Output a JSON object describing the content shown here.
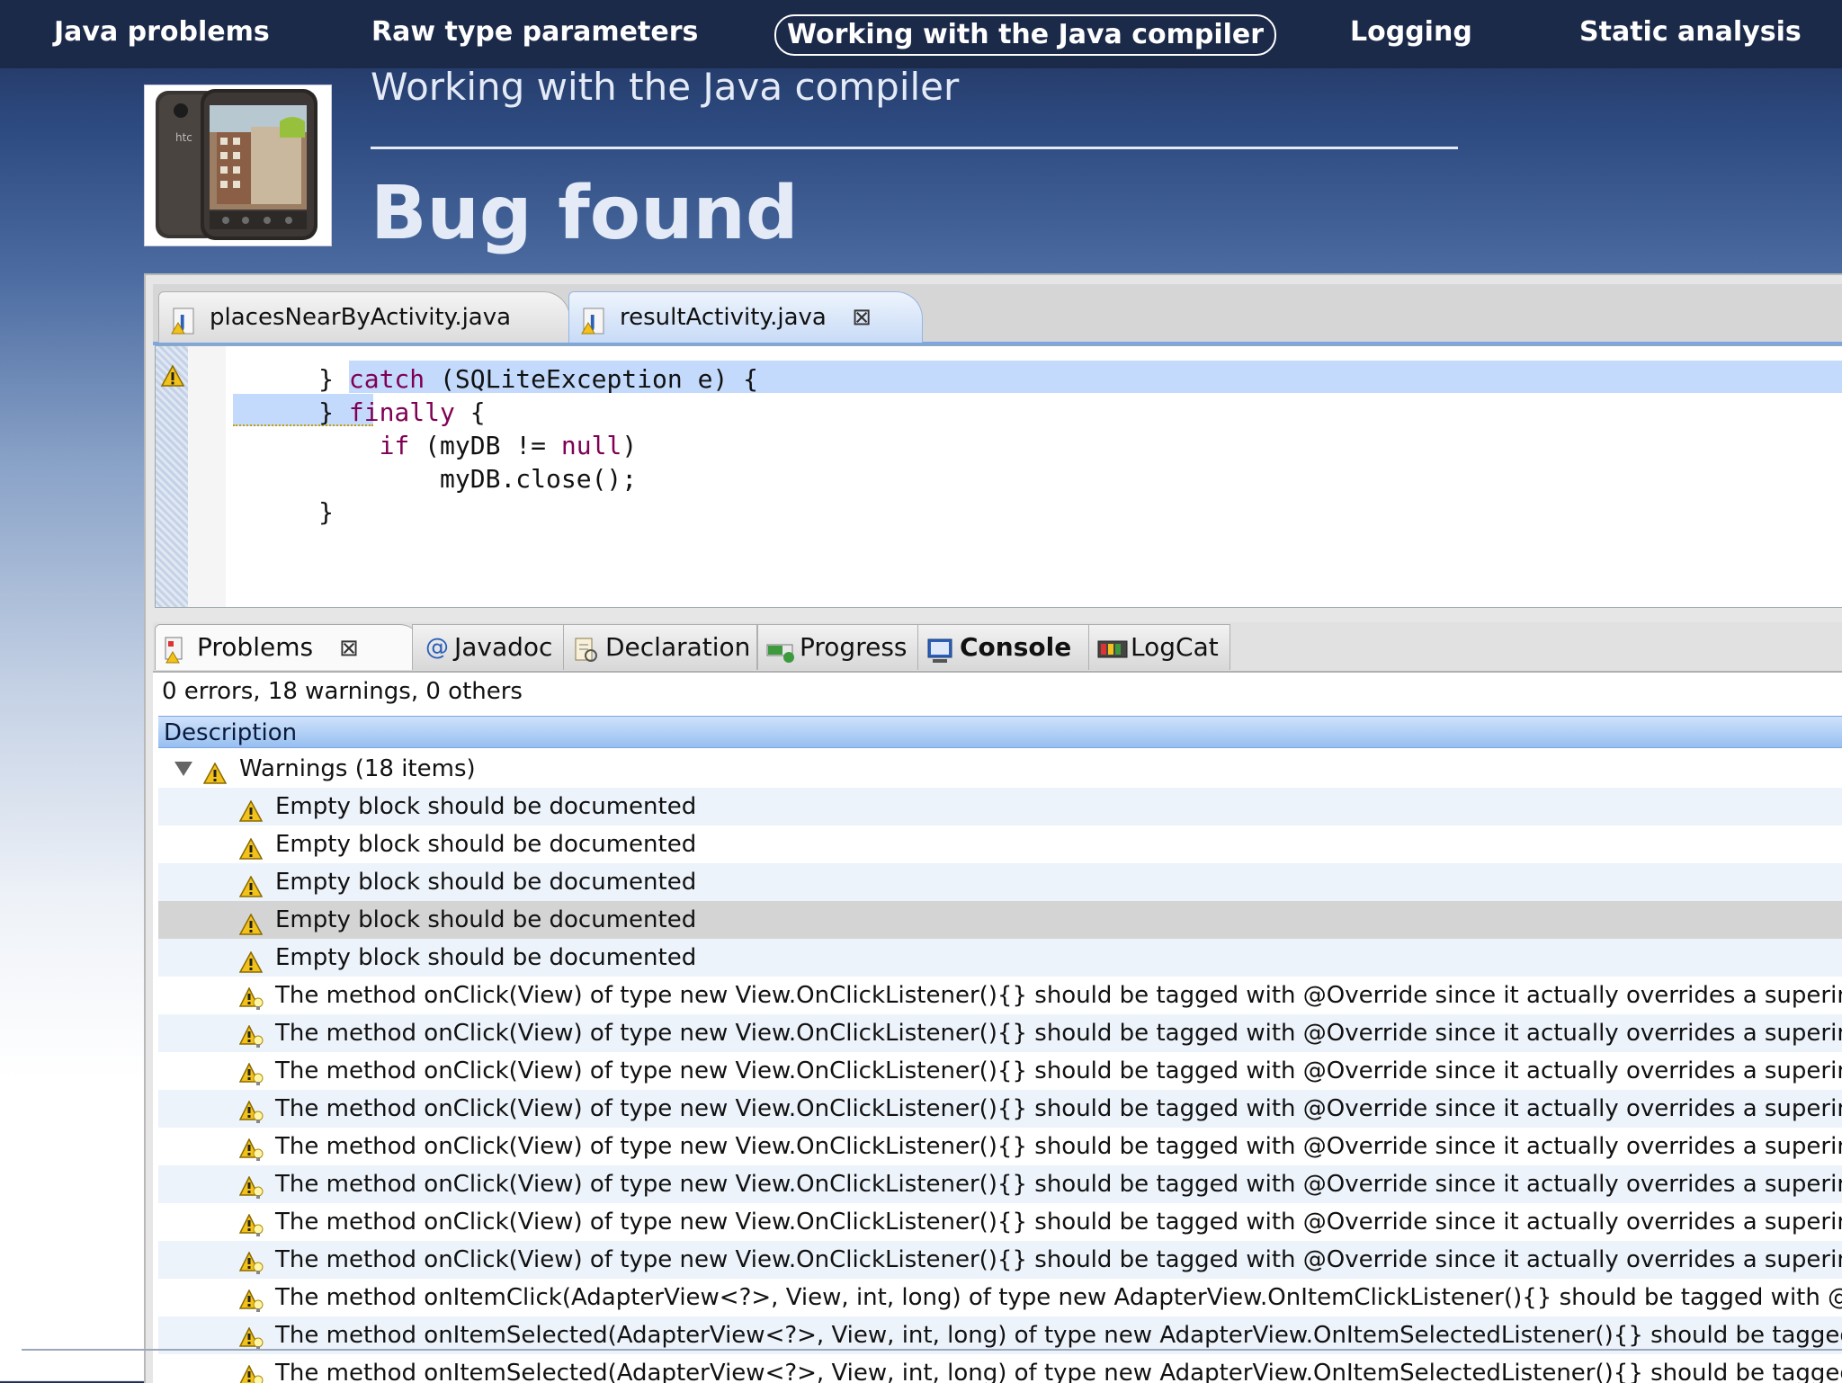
{
  "nav": {
    "items": [
      {
        "label": "Java problems",
        "active": false
      },
      {
        "label": "Raw type parameters",
        "active": false
      },
      {
        "label": "Working with the Java compiler",
        "active": true
      },
      {
        "label": "Logging",
        "active": false
      },
      {
        "label": "Static analysis",
        "active": false
      }
    ]
  },
  "slide": {
    "subtitle": "Working with the Java compiler",
    "title": "Bug found",
    "phone_logo": "htc"
  },
  "editor": {
    "tabs": [
      {
        "label": "placesNearByActivity.java",
        "active": false
      },
      {
        "label": "resultActivity.java",
        "active": true
      }
    ],
    "code": [
      {
        "pre": "      } ",
        "kw": "catch",
        "post": " (SQLiteException e) {"
      },
      {
        "pre": "      } ",
        "kw": "finally",
        "post": " {"
      },
      {
        "pre": "          ",
        "kw": "if",
        "post": " (myDB != ",
        "kw2": "null",
        "post2": ")"
      },
      {
        "pre": "              myDB.close();",
        "kw": "",
        "post": ""
      },
      {
        "pre": "      }",
        "kw": "",
        "post": ""
      }
    ]
  },
  "problems": {
    "tabs": [
      {
        "label": "Problems",
        "icon": "problems-icon",
        "active": true
      },
      {
        "label": "Javadoc",
        "icon": "at-sign-icon",
        "active": false
      },
      {
        "label": "Declaration",
        "icon": "declaration-icon",
        "active": false
      },
      {
        "label": "Progress",
        "icon": "progress-icon",
        "active": false
      },
      {
        "label": "Console",
        "icon": "console-icon",
        "active": false
      },
      {
        "label": "LogCat",
        "icon": "logcat-icon",
        "active": false
      }
    ],
    "summary": "0 errors, 18 warnings, 0 others",
    "column": "Description",
    "group": "Warnings (18 items)",
    "rows": [
      {
        "text": "Empty block should be documented",
        "kind": "warning"
      },
      {
        "text": "Empty block should be documented",
        "kind": "warning"
      },
      {
        "text": "Empty block should be documented",
        "kind": "warning"
      },
      {
        "text": "Empty block should be documented",
        "kind": "warning",
        "selected": true
      },
      {
        "text": "Empty block should be documented",
        "kind": "warning"
      },
      {
        "text": "The method onClick(View) of type new View.OnClickListener(){} should be tagged with @Override since it actually overrides a superin",
        "kind": "quickfix"
      },
      {
        "text": "The method onClick(View) of type new View.OnClickListener(){} should be tagged with @Override since it actually overrides a superin",
        "kind": "quickfix"
      },
      {
        "text": "The method onClick(View) of type new View.OnClickListener(){} should be tagged with @Override since it actually overrides a superin",
        "kind": "quickfix"
      },
      {
        "text": "The method onClick(View) of type new View.OnClickListener(){} should be tagged with @Override since it actually overrides a superin",
        "kind": "quickfix"
      },
      {
        "text": "The method onClick(View) of type new View.OnClickListener(){} should be tagged with @Override since it actually overrides a superin",
        "kind": "quickfix"
      },
      {
        "text": "The method onClick(View) of type new View.OnClickListener(){} should be tagged with @Override since it actually overrides a superin",
        "kind": "quickfix"
      },
      {
        "text": "The method onClick(View) of type new View.OnClickListener(){} should be tagged with @Override since it actually overrides a superin",
        "kind": "quickfix"
      },
      {
        "text": "The method onClick(View) of type new View.OnClickListener(){} should be tagged with @Override since it actually overrides a superin",
        "kind": "quickfix"
      },
      {
        "text": "The method onItemClick(AdapterView<?>, View, int, long) of type new AdapterView.OnItemClickListener(){} should be tagged with @",
        "kind": "quickfix"
      },
      {
        "text": "The method onItemSelected(AdapterView<?>, View, int, long) of type new AdapterView.OnItemSelectedListener(){} should be tagged",
        "kind": "quickfix"
      },
      {
        "text": "The method onItemSelected(AdapterView<?>, View, int, long) of type new AdapterView.OnItemSelectedListener(){} should be tagged",
        "kind": "quickfix"
      }
    ]
  },
  "colors": {
    "nav_bg": "#1c2a4a",
    "selection_blue": "#c3dafc",
    "keyword": "#7f0055",
    "warning_yellow": "#f2c21a"
  }
}
